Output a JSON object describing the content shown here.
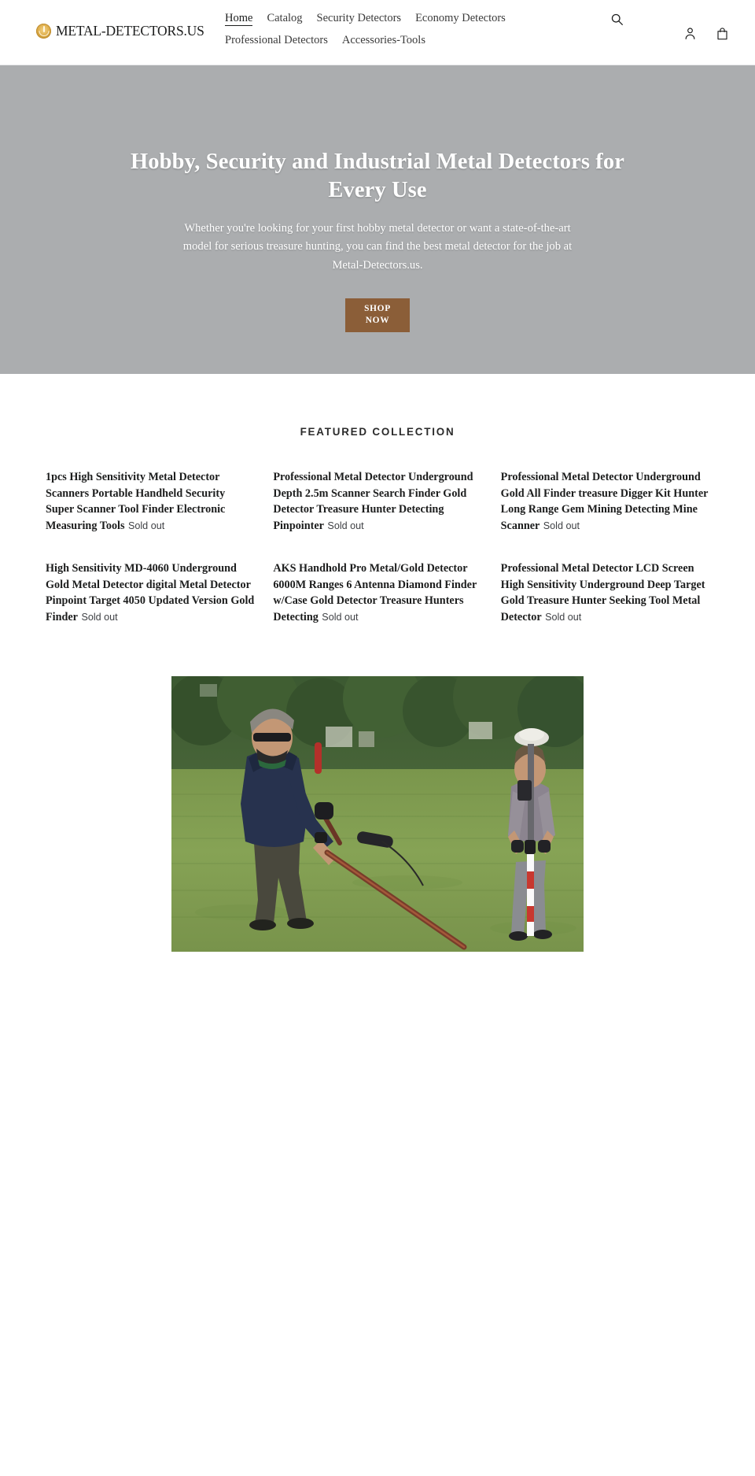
{
  "header": {
    "logo_text": "METAL-DETECTORS.US",
    "logo_icon": "flame-coin-icon",
    "nav_row1": [
      {
        "label": "Home",
        "active": true
      },
      {
        "label": "Catalog",
        "active": false
      },
      {
        "label": "Security Detectors",
        "active": false
      },
      {
        "label": "Economy Detectors",
        "active": false
      }
    ],
    "nav_row2": [
      {
        "label": "Professional Detectors",
        "active": false
      },
      {
        "label": "Accessories-Tools",
        "active": false
      }
    ],
    "icons": {
      "search": "search-icon",
      "account": "account-icon",
      "cart": "cart-icon"
    }
  },
  "hero": {
    "title": "Hobby, Security and Industrial Metal Detectors for Every Use",
    "subtitle": "Whether you're looking for your first hobby metal detector or want a state-of-the-art model for serious treasure hunting, you can find the best metal detector for the job at Metal-Detectors.us.",
    "cta_line1": "SHOP",
    "cta_line2": "NOW",
    "background_color": "#abadaf",
    "cta_color": "#8b5e38"
  },
  "featured": {
    "heading": "FEATURED COLLECTION",
    "products": [
      {
        "title": "1pcs High Sensitivity Metal Detector Scanners Portable Handheld Security Super Scanner Tool Finder Electronic Measuring Tools",
        "status": "Sold out"
      },
      {
        "title": "Professional Metal Detector Underground Depth 2.5m Scanner Search Finder Gold Detector Treasure Hunter Detecting Pinpointer",
        "status": "Sold out"
      },
      {
        "title": "Professional Metal Detector Underground Gold All Finder treasure Digger Kit Hunter Long Range Gem Mining Detecting Mine Scanner",
        "status": "Sold out"
      },
      {
        "title": "High Sensitivity MD-4060 Underground Gold Metal Detector digital Metal Detector Pinpoint Target 4050 Updated Version Gold Finder",
        "status": "Sold out"
      },
      {
        "title": "AKS Handhold Pro Metal/Gold Detector 6000M Ranges 6 Antenna Diamond Finder w/Case Gold Detector Treasure Hunters Detecting",
        "status": "Sold out"
      },
      {
        "title": "Professional Metal Detector LCD Screen High Sensitivity Underground Deep Target Gold Treasure Hunter Seeking Tool Metal Detector",
        "status": "Sold out"
      }
    ]
  },
  "photo": {
    "name": "metal-detecting-field-photo",
    "alt": "Two people metal detecting in a grass field with trees in the background"
  }
}
